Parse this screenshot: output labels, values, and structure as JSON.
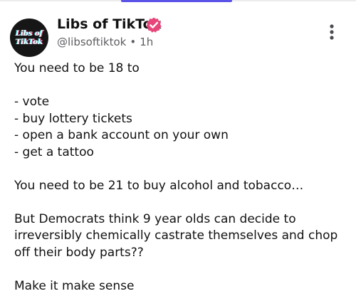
{
  "post": {
    "author_name": "Libs of TikTok",
    "handle": "@libsoftiktok",
    "separator": "•",
    "timestamp": "1h",
    "verified_icon": "verified-badge-icon",
    "more_icon": "more-vertical-icon",
    "avatar_text": {
      "line1": "Libs of",
      "line2": "TikTok"
    },
    "body": "You need to be 18 to\n\n- vote\n- buy lottery tickets\n- open a bank account on your own\n- get a tattoo\n\nYou need to be 21 to buy alcohol and tobacco…\n\nBut Democrats think 9 year olds can decide to irreversibly chemically castrate themselves and chop off their body parts??\n\nMake it make sense"
  },
  "colors": {
    "accent_tab": "#5b53e8",
    "verified_badge": "#e8467a",
    "text_primary": "#111111",
    "text_secondary": "#5e5e63"
  }
}
